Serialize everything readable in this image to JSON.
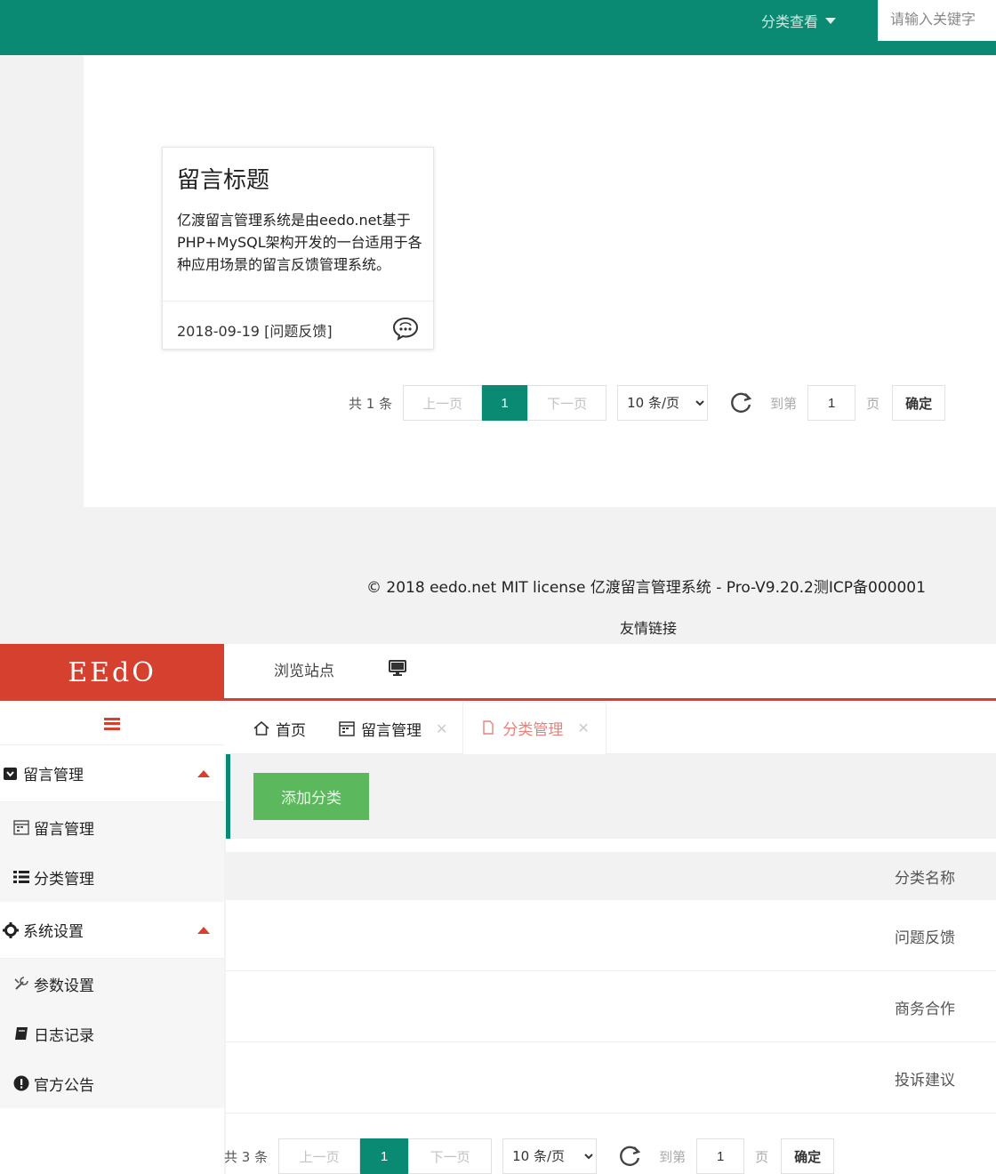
{
  "front": {
    "category_view": "分类查看",
    "search_placeholder": "请输入关键字",
    "card": {
      "title": "留言标题",
      "body": "亿渡留言管理系统是由eedo.net基于PHP+MySQL架构开发的一台适用于各种应用场景的留言反馈管理系统。",
      "date_tag": "2018-09-19 [问题反馈]",
      "chat_icon": "chat-bubble-icon"
    },
    "pager": {
      "total": "共 1 条",
      "prev": "上一页",
      "current": "1",
      "next": "下一页",
      "per_page": "10 条/页",
      "goto": "到第",
      "page_value": "1",
      "page": "页",
      "confirm": "确定"
    },
    "footer": "© 2018 eedo.net MIT license  亿渡留言管理系统 - Pro-V9.20.2测ICP备000001",
    "friend_links": "友情链接"
  },
  "admin": {
    "logo": "EEdO",
    "browse_site": "浏览站点",
    "sidebar": {
      "groups": [
        {
          "label": "留言管理",
          "items": [
            "留言管理",
            "分类管理"
          ]
        },
        {
          "label": "系统设置",
          "items": [
            "参数设置",
            "日志记录",
            "官方公告"
          ]
        }
      ]
    },
    "tabs": [
      {
        "label": "首页"
      },
      {
        "label": "留言管理"
      },
      {
        "label": "分类管理"
      }
    ],
    "add_category": "添加分类",
    "table": {
      "header": "分类名称",
      "rows": [
        "问题反馈",
        "商务合作",
        "投诉建议"
      ]
    },
    "pager": {
      "total": "共 3 条",
      "prev": "上一页",
      "current": "1",
      "next": "下一页",
      "per_page": "10 条/页",
      "goto": "到第",
      "page_value": "1",
      "page": "页",
      "confirm": "确定"
    }
  },
  "colors": {
    "teal": "#0a8a72",
    "red": "#d6402f",
    "green_button": "#5cb85c"
  }
}
